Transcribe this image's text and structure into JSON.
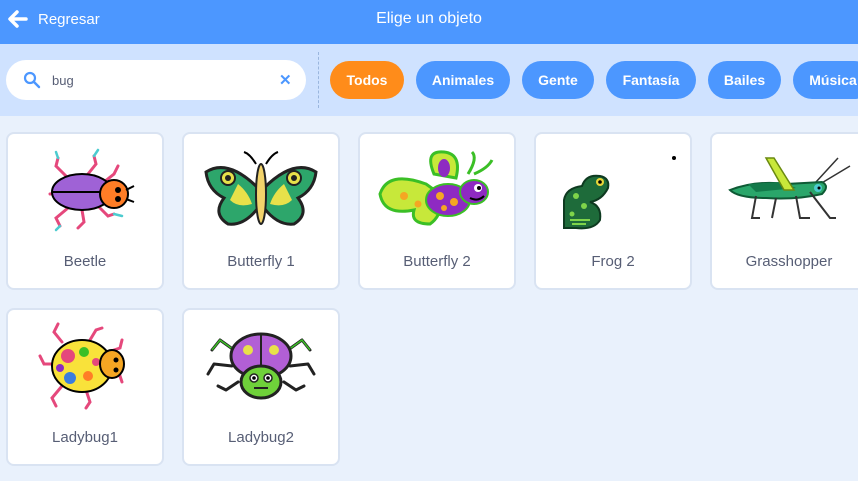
{
  "header": {
    "back_label": "Regresar",
    "title": "Elige un objeto"
  },
  "search": {
    "value": "bug",
    "clear_icon": "close-icon"
  },
  "tags": [
    {
      "label": "Todos",
      "active": true
    },
    {
      "label": "Animales"
    },
    {
      "label": "Gente"
    },
    {
      "label": "Fantasía"
    },
    {
      "label": "Bailes"
    },
    {
      "label": "Música"
    }
  ],
  "sprites": [
    {
      "name": "Beetle"
    },
    {
      "name": "Butterfly 1"
    },
    {
      "name": "Butterfly 2"
    },
    {
      "name": "Frog 2"
    },
    {
      "name": "Grasshopper"
    },
    {
      "name": "Ladybug1"
    },
    {
      "name": "Ladybug2"
    }
  ],
  "colors": {
    "header": "#4c97ff",
    "filter_bar": "#cfe2ff",
    "active_tag": "#ff8c1a",
    "tag": "#4c97ff",
    "background": "#e9f1fc"
  }
}
